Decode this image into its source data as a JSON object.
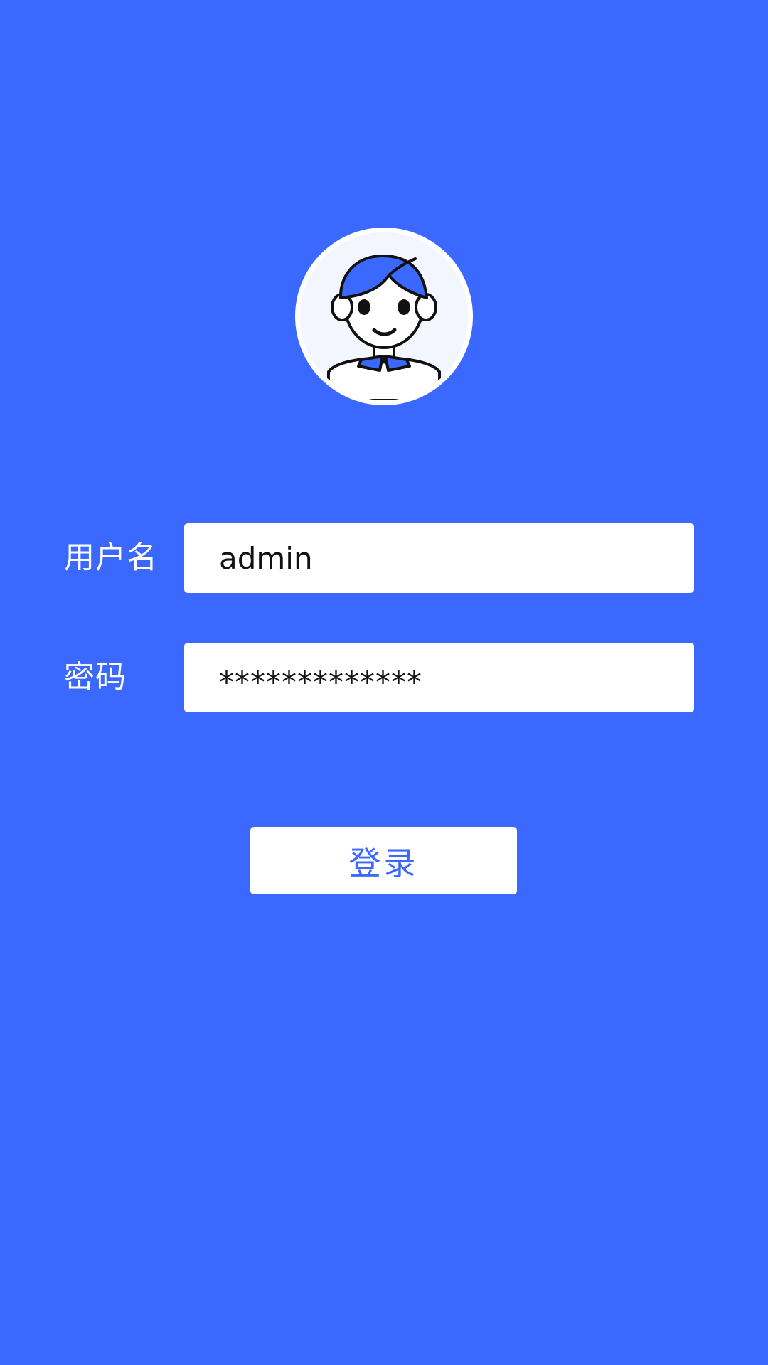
{
  "colors": {
    "background": "#3b69ff",
    "field_background": "#ffffff",
    "avatar_accent": "#3b69ff",
    "button_text": "#3b69ff"
  },
  "avatar": {
    "icon": "user-avatar-icon"
  },
  "login_form": {
    "username_label": "用户名",
    "username_value": "admin",
    "password_label": "密码",
    "password_value": "*************",
    "login_button_label": "登录"
  }
}
